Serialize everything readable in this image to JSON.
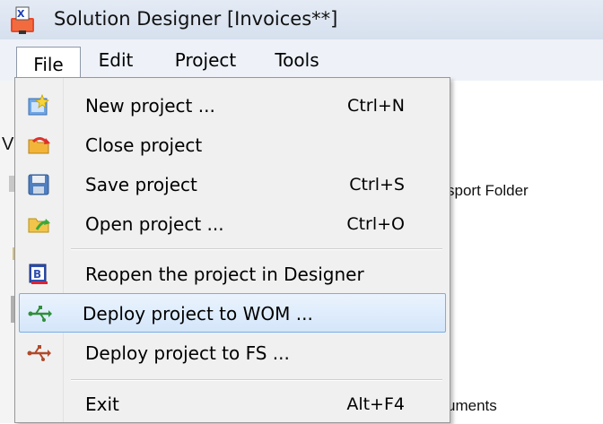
{
  "window": {
    "title": "Solution Designer [Invoices**]",
    "icon": "solution-designer-app-icon"
  },
  "menubar": {
    "items": [
      "File",
      "Edit",
      "Project",
      "Tools"
    ],
    "active": "File"
  },
  "file_menu": {
    "items": [
      {
        "label": "New project ...",
        "shortcut": "Ctrl+N",
        "icon": "new-project-icon"
      },
      {
        "label": "Close project",
        "shortcut": "",
        "icon": "close-project-icon"
      },
      {
        "label": "Save project",
        "shortcut": "Ctrl+S",
        "icon": "save-icon"
      },
      {
        "label": "Open project ...",
        "shortcut": "Ctrl+O",
        "icon": "open-project-icon"
      },
      {
        "label": "Reopen the project in Designer",
        "shortcut": "",
        "icon": "designer-icon"
      },
      {
        "label": "Deploy project to WOM ...",
        "shortcut": "",
        "icon": "usb-deploy-icon",
        "highlighted": true
      },
      {
        "label": "Deploy project to FS ...",
        "shortcut": "",
        "icon": "usb-deploy-fs-icon"
      },
      {
        "label": "Exit",
        "shortcut": "Alt+F4",
        "icon": ""
      }
    ]
  },
  "background": {
    "partial_text_1": "sport Folder",
    "partial_text_2": "uments",
    "partial_letter": "V"
  },
  "colors": {
    "highlight_border": "#7aaee6",
    "highlight_fill": "#d4e6fa",
    "menu_bg": "#f0f0f0",
    "titlebar_bg": "#dbe4f1"
  }
}
